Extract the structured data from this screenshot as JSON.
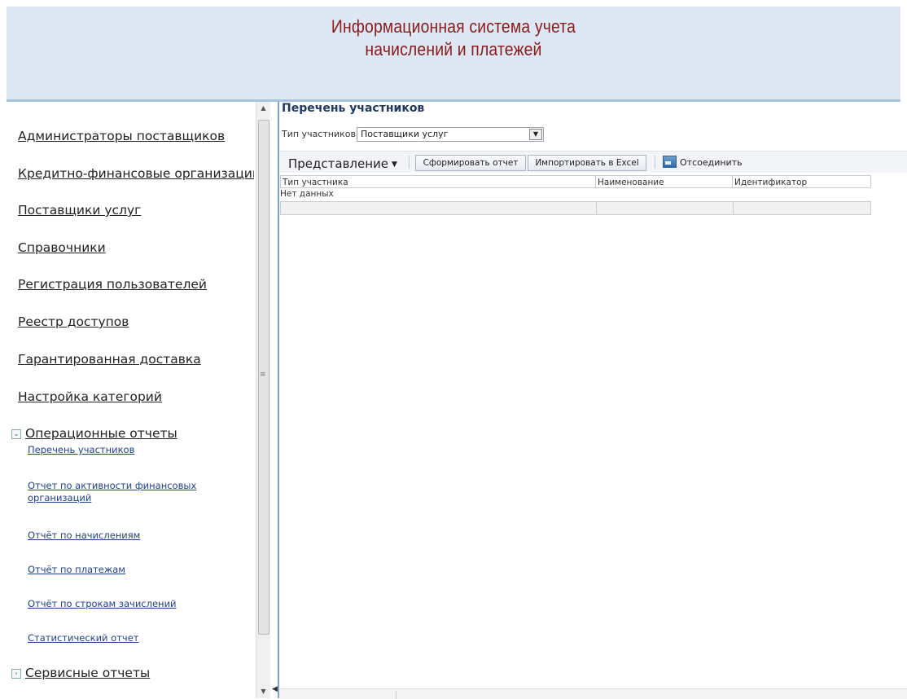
{
  "header": {
    "title_line1": "Информационная система учета",
    "title_line2": "начислений и платежей"
  },
  "sidebar": {
    "items": [
      {
        "label": "Администраторы поставщиков"
      },
      {
        "label": "Кредитно-финансовые организации"
      },
      {
        "label": "Поставщики услуг"
      },
      {
        "label": "Справочники"
      },
      {
        "label": "Регистрация пользователей"
      },
      {
        "label": "Реестр доступов"
      },
      {
        "label": "Гарантированная доставка"
      },
      {
        "label": "Настройка категорий"
      }
    ],
    "operational_reports": {
      "label": "Операционные отчеты",
      "expanded": true,
      "items": [
        {
          "label": "Перечень участников"
        },
        {
          "label": "Отчет по активности финансовых организаций"
        },
        {
          "label": "Отчёт по начислениям"
        },
        {
          "label": "Отчёт по платежам"
        },
        {
          "label": "Отчёт по строкам зачислений"
        },
        {
          "label": "Статистический отчет"
        }
      ]
    },
    "service_reports": {
      "label": "Сервисные отчеты",
      "expanded": false
    }
  },
  "main": {
    "title": "Перечень участников",
    "filter": {
      "label": "Тип участников",
      "value": "Поставщики услуг"
    },
    "toolbar": {
      "view_label": "Представление",
      "report_button": "Сформировать отчет",
      "excel_button": "Импортировать в Excel",
      "detach_label": "Отсоединить"
    },
    "grid": {
      "columns": [
        "Тип участника",
        "Наименование",
        "Идентификатор"
      ],
      "empty_text": "Нет данных"
    }
  },
  "icons": {
    "expand_collapsed": "chevron-right-icon",
    "expand_expanded": "chevron-down-icon",
    "detach": "detach-icon",
    "dropdown": "dropdown-arrow-icon"
  },
  "colors": {
    "header_bg": "#dde8f4",
    "header_title": "#8b1a1a",
    "link": "#1f3f8f",
    "page_title": "#1f3864"
  }
}
